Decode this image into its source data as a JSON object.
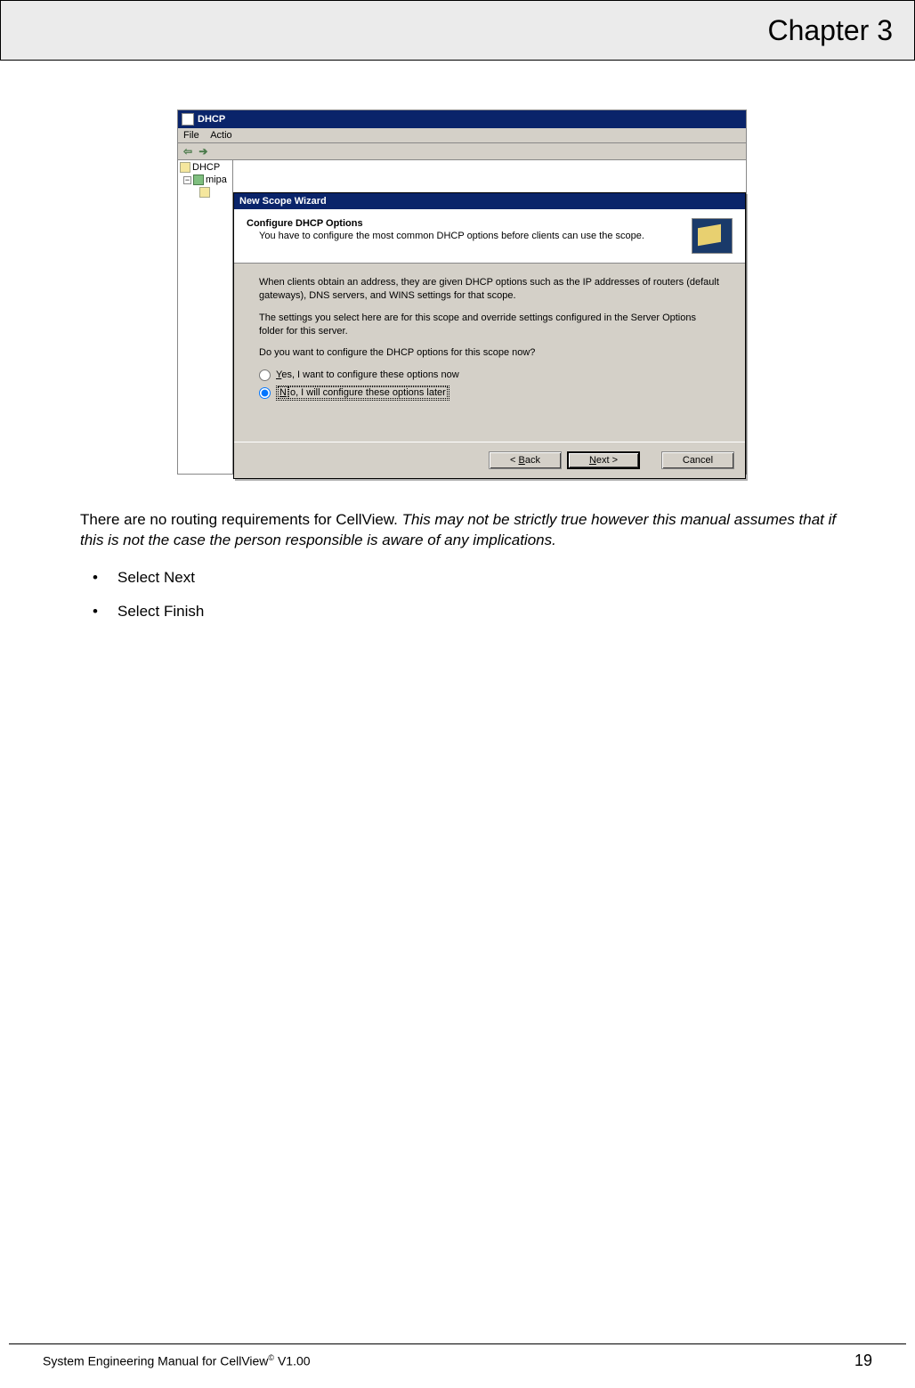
{
  "header": {
    "title": "Chapter 3"
  },
  "screenshot": {
    "window_title": "DHCP",
    "menus": [
      "File",
      "Actio"
    ],
    "toolbar": {
      "back": "⇦",
      "fwd": "➔"
    },
    "tree": {
      "root": "DHCP",
      "child1": "mipa",
      "plus": "−"
    },
    "wizard": {
      "title": "New Scope Wizard",
      "heading": "Configure DHCP Options",
      "subheading": "You have to configure the most common DHCP options before clients can use the scope.",
      "para1": "When clients obtain an address, they are given DHCP options such as the IP addresses of routers (default gateways), DNS servers, and WINS settings for that scope.",
      "para2": "The settings you select here are for this scope and override settings configured in the Server Options folder for this server.",
      "para3": "Do you want to configure the DHCP options for this scope now?",
      "opt_yes": "Yes, I want to configure these options now",
      "opt_yes_hot": "Y",
      "opt_no": "No, I will configure these options later",
      "opt_no_hot": "N",
      "btn_back": "< Back",
      "btn_back_hot": "B",
      "btn_next": "Next >",
      "btn_next_hot": "N",
      "btn_cancel": "Cancel"
    }
  },
  "body": {
    "para_plain": "There are no routing requirements for CellView. ",
    "para_italic": "This may not be strictly true however this manual assumes that if this is not the case the person responsible is aware of any implications.",
    "bullets": [
      "Select Next",
      "Select Finish"
    ]
  },
  "footer": {
    "left_a": "System Engineering Manual for CellView",
    "left_sup": "©",
    "left_b": " V1.00",
    "page": "19"
  }
}
